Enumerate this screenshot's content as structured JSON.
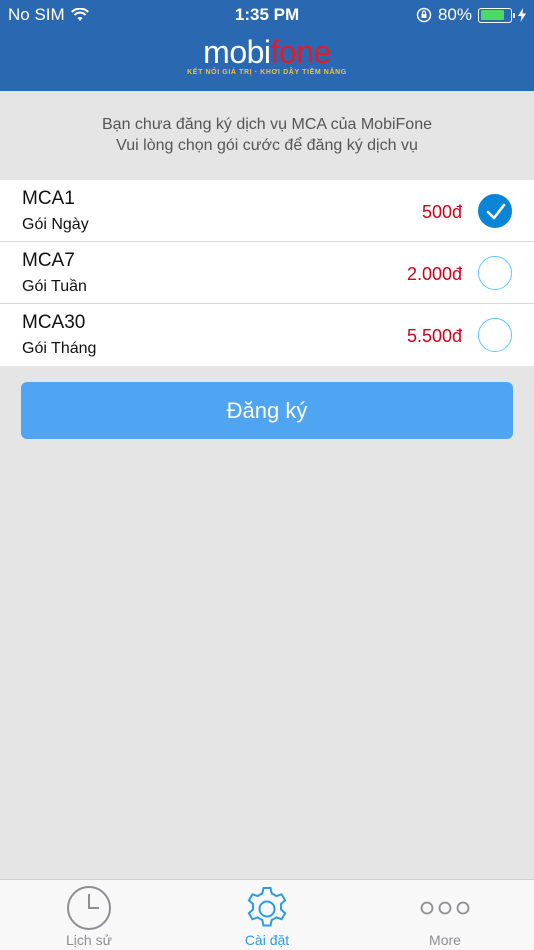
{
  "status_bar": {
    "carrier": "No SIM",
    "time": "1:35 PM",
    "battery_percent": "80%",
    "battery_level": 0.8
  },
  "header": {
    "logo_mobi": "mobi",
    "logo_fone": "fone",
    "logo_tagline": "KẾT NỐI GIÁ TRỊ · KHƠI DẬY TIỀM NĂNG"
  },
  "intro": {
    "line1": "Bạn chưa đăng ký dịch vụ MCA của MobiFone",
    "line2": "Vui lòng chọn gói cước để đăng ký dịch vụ"
  },
  "plans": [
    {
      "name": "MCA1",
      "desc": "Gói Ngày",
      "price": "500đ",
      "selected": true
    },
    {
      "name": "MCA7",
      "desc": "Gói Tuần",
      "price": "2.000đ",
      "selected": false
    },
    {
      "name": "MCA30",
      "desc": "Gói Tháng",
      "price": "5.500đ",
      "selected": false
    }
  ],
  "register_button": "Đăng ký",
  "tabbar": {
    "tabs": [
      {
        "label": "Lịch sử",
        "icon": "clock-icon",
        "active": false
      },
      {
        "label": "Cài đặt",
        "icon": "gear-icon",
        "active": true
      },
      {
        "label": "More",
        "icon": "more-icon",
        "active": false
      }
    ]
  },
  "colors": {
    "header_bg": "#2a69b1",
    "price": "#d0021b",
    "accent": "#2b9be6",
    "button_bg": "#4fa5f2"
  }
}
